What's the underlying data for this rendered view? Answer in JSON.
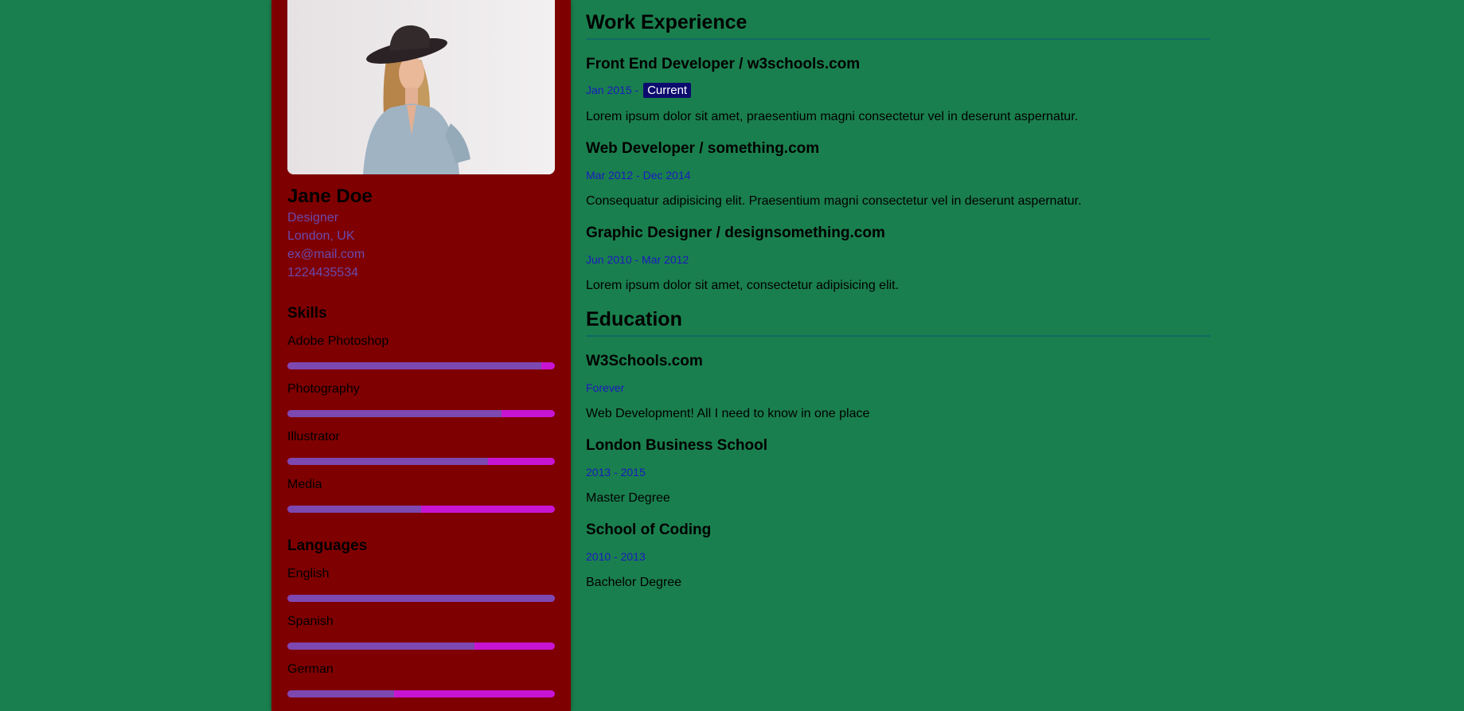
{
  "profile": {
    "name": "Jane Doe",
    "role": "Designer",
    "location": "London, UK",
    "email": "ex@mail.com",
    "phone": "1224435534"
  },
  "skills": {
    "title": "Skills",
    "items": [
      {
        "label": "Adobe Photoshop",
        "percent": 95
      },
      {
        "label": "Photography",
        "percent": 80
      },
      {
        "label": "Illustrator",
        "percent": 75
      },
      {
        "label": "Media",
        "percent": 50
      }
    ]
  },
  "languages": {
    "title": "Languages",
    "items": [
      {
        "label": "English",
        "percent": 100
      },
      {
        "label": "Spanish",
        "percent": 70
      },
      {
        "label": "German",
        "percent": 40
      }
    ]
  },
  "work": {
    "title": "Work Experience",
    "entries": [
      {
        "title": "Front End Developer / w3schools.com",
        "date": "Jan 2015 - ",
        "badge": "Current",
        "text": "Lorem ipsum dolor sit amet, praesentium magni consectetur vel in deserunt aspernatur."
      },
      {
        "title": "Web Developer / something.com",
        "date": "Mar 2012 - Dec 2014",
        "text": "Consequatur adipisicing elit. Praesentium magni consectetur vel in deserunt aspernatur."
      },
      {
        "title": "Graphic Designer / designsomething.com",
        "date": "Jun 2010 - Mar 2012",
        "text": "Lorem ipsum dolor sit amet, consectetur adipisicing elit."
      }
    ]
  },
  "education": {
    "title": "Education",
    "entries": [
      {
        "title": "W3Schools.com",
        "date": "Forever",
        "text": "Web Development! All I need to know in one place"
      },
      {
        "title": "London Business School",
        "date": "2013 - 2015",
        "text": "Master Degree"
      },
      {
        "title": "School of Coding",
        "date": "2010 - 2013",
        "text": "Bachelor Degree"
      }
    ]
  },
  "colors": {
    "page_bg": "#1a7f4e",
    "sidebar_bg": "#7f0000",
    "bar_fill": "#7d48b0",
    "bar_track": "#c714d3",
    "date_text": "#1a1abf",
    "badge_bg": "#0c0c6e",
    "rule": "#116b64"
  }
}
